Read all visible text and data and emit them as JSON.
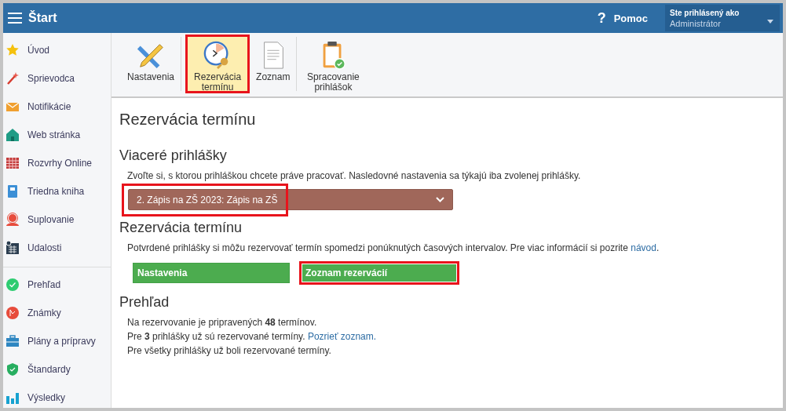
{
  "topbar": {
    "title": "Štart",
    "help_icon": "?",
    "help": "Pomoc",
    "user_label": "Ste prihlásený ako",
    "user_name": "Administrátor"
  },
  "sidebar": {
    "groups": [
      [
        {
          "label": "Úvod"
        },
        {
          "label": "Sprievodca"
        },
        {
          "label": "Notifikácie"
        },
        {
          "label": "Web stránka"
        },
        {
          "label": "Rozvrhy Online"
        },
        {
          "label": "Triedna kniha"
        },
        {
          "label": "Suplovanie"
        },
        {
          "label": "Udalosti"
        }
      ],
      [
        {
          "label": "Prehľad"
        },
        {
          "label": "Známky"
        },
        {
          "label": "Plány a prípravy"
        },
        {
          "label": "Štandardy"
        },
        {
          "label": "Výsledky"
        }
      ]
    ]
  },
  "toolbar": [
    {
      "label": "Nastavenia",
      "selected": false,
      "highlighted": false,
      "separator_after": true
    },
    {
      "label": "Rezervácia termínu",
      "selected": true,
      "highlighted": true,
      "separator_after": false
    },
    {
      "label": "Zoznam",
      "selected": false,
      "highlighted": false,
      "separator_after": true
    },
    {
      "label": "Spracovanie prihlášok",
      "selected": false,
      "highlighted": false,
      "separator_after": false
    }
  ],
  "page_title": "Rezervácia termínu",
  "applications": {
    "heading": "Viaceré prihlášky",
    "description": "Zvoľte si, s ktorou prihláškou chcete práve pracovať. Nasledovné nastavenia sa týkajú iba zvolenej prihlášky.",
    "select_value": "2. Zápis na ZŠ 2023: Zápis na ZŠ",
    "highlighted": true
  },
  "reservation": {
    "heading": "Rezervácia termínu",
    "description": "Potvrdené prihlášky si môžu rezervovať termín spomedzi ponúknutých časových intervalov. Pre viac informácií si pozrite",
    "link": "návod",
    "after_link": ".",
    "buttons": [
      {
        "label": "Nastavenia",
        "highlighted": false
      },
      {
        "label": "Zoznam rezervácií",
        "highlighted": true
      }
    ]
  },
  "overview": {
    "heading": "Prehľad",
    "lines": [
      {
        "text": "Na rezervovanie je pripravených **48** termínov."
      },
      {
        "text": "Pre **3** prihlášky už sú rezervované termíny.",
        "link": "Pozrieť zoznam."
      },
      {
        "text": "Pre všetky prihlášky už boli rezervované termíny."
      }
    ]
  }
}
